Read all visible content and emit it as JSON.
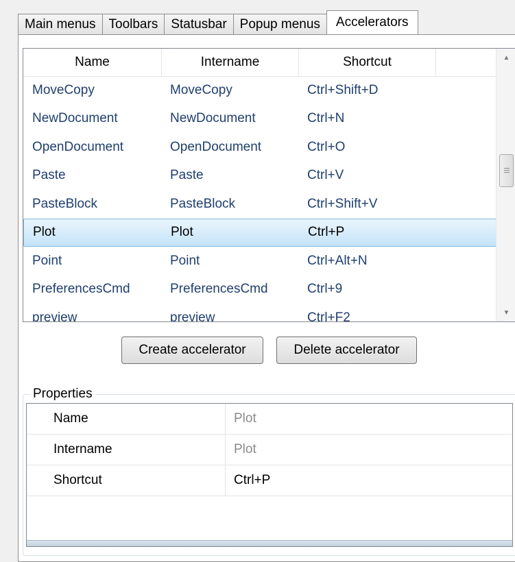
{
  "tabs": [
    {
      "label": "Main menus"
    },
    {
      "label": "Toolbars"
    },
    {
      "label": "Statusbar"
    },
    {
      "label": "Popup menus"
    },
    {
      "label": "Accelerators"
    }
  ],
  "active_tab": "Accelerators",
  "accelerators": {
    "columns": [
      "Name",
      "Intername",
      "Shortcut"
    ],
    "rows": [
      {
        "name": "MoveCopy",
        "intername": "MoveCopy",
        "shortcut": "Ctrl+Shift+D"
      },
      {
        "name": "NewDocument",
        "intername": "NewDocument",
        "shortcut": "Ctrl+N"
      },
      {
        "name": "OpenDocument",
        "intername": "OpenDocument",
        "shortcut": "Ctrl+O"
      },
      {
        "name": "Paste",
        "intername": "Paste",
        "shortcut": "Ctrl+V"
      },
      {
        "name": "PasteBlock",
        "intername": "PasteBlock",
        "shortcut": "Ctrl+Shift+V"
      },
      {
        "name": "Plot",
        "intername": "Plot",
        "shortcut": "Ctrl+P"
      },
      {
        "name": "Point",
        "intername": "Point",
        "shortcut": "Ctrl+Alt+N"
      },
      {
        "name": "PreferencesCmd",
        "intername": "PreferencesCmd",
        "shortcut": "Ctrl+9"
      },
      {
        "name": "preview",
        "intername": "preview",
        "shortcut": "Ctrl+F2"
      }
    ],
    "selected_row": 5
  },
  "buttons": {
    "create": "Create accelerator",
    "delete": "Delete accelerator"
  },
  "properties": {
    "legend": "Properties",
    "rows": [
      {
        "name": "Name",
        "value": "Plot"
      },
      {
        "name": "Intername",
        "value": "Plot"
      },
      {
        "name": "Shortcut",
        "value": "Ctrl+P"
      }
    ]
  },
  "colors": {
    "selection_border": "#7fb9e2",
    "list_text": "#1f3f6e",
    "readonly_value": "#8a8a8a"
  }
}
